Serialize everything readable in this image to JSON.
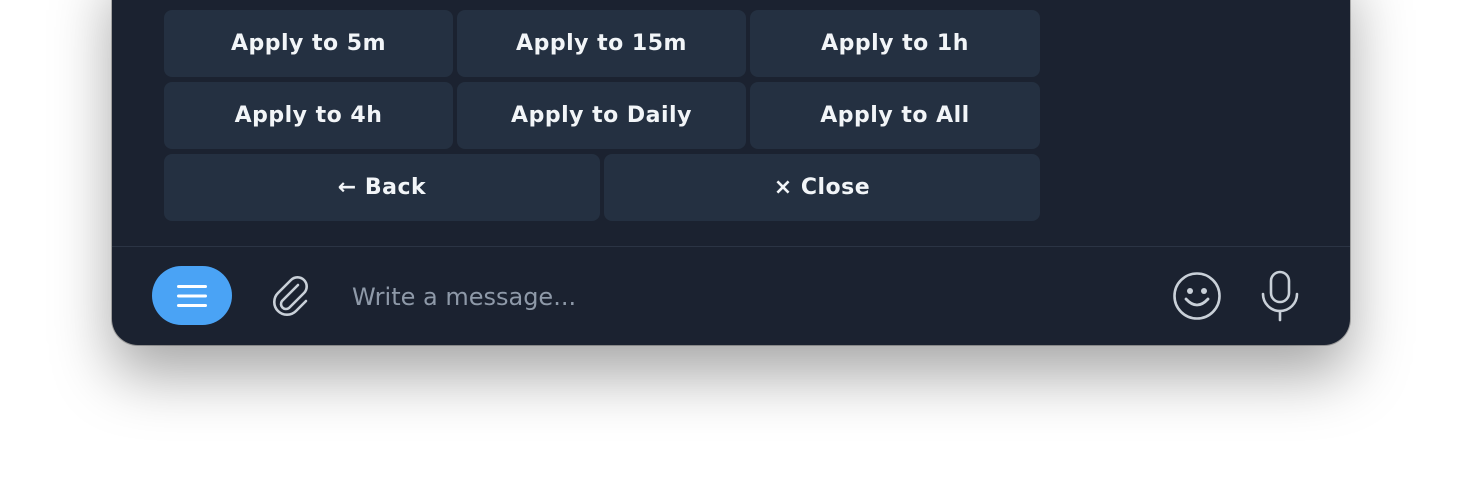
{
  "keyboard": {
    "rows": [
      [
        "Apply to 5m",
        "Apply to 15m",
        "Apply to 1h"
      ],
      [
        "Apply to 4h",
        "Apply to Daily",
        "Apply to All"
      ],
      [
        "← Back",
        "× Close"
      ]
    ]
  },
  "composer": {
    "placeholder": "Write a message...",
    "icons": {
      "menu": "menu-icon",
      "attach": "paperclip-icon",
      "emoji": "smiley-icon",
      "mic": "microphone-icon"
    }
  },
  "colors": {
    "background": "#1b2230",
    "button": "#243041",
    "accent": "#4aa3f5",
    "text": "#f2f5f8",
    "icon": "#c9d0d8"
  }
}
